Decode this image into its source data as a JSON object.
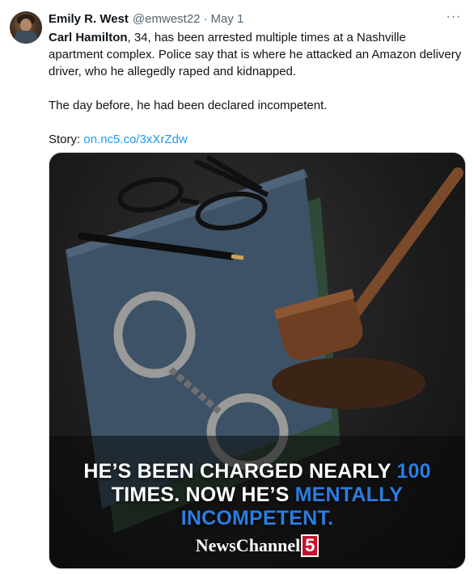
{
  "author": {
    "name": "Emily R. West",
    "handle": "@emwest22",
    "separator": "·",
    "date": "May 1"
  },
  "menu": {
    "more_label": "···"
  },
  "post": {
    "line1_name": "Carl Hamilton",
    "line1_rest": ", 34, has been arrested multiple times at a Nashville apartment complex. Police say that is where he attacked an Amazon delivery driver, who he allegedly raped and kidnapped.",
    "line2": "The day before, he had been declared incompetent.",
    "story_label": "Story: ",
    "story_link": "on.nc5.co/3xXrZdw"
  },
  "media": {
    "caption_part1": "HE’S BEEN CHARGED NEARLY ",
    "caption_hl1": "100",
    "caption_part2": "TIMES. NOW HE’S ",
    "caption_hl2": "MENTALLY",
    "caption_hl3": "INCOMPETENT.",
    "logo_text": "NewsChannel",
    "logo_number": "5"
  },
  "colors": {
    "link": "#1d9bf0",
    "caption_highlight": "#2a7de1",
    "logo_badge": "#c8102e"
  }
}
